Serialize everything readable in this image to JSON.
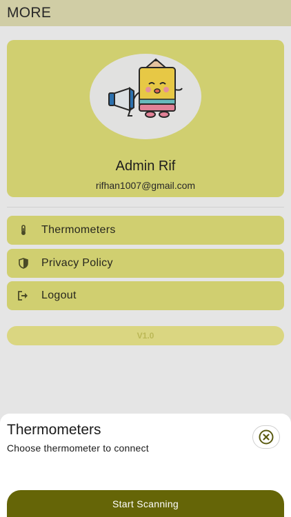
{
  "app_bar": {
    "title": "MORE"
  },
  "profile": {
    "name": "Admin Rif",
    "email": "rifhan1007@gmail.com",
    "avatar_icon": "pencil-mascot-megaphone-icon"
  },
  "menu": [
    {
      "label": "Thermometers",
      "icon": "thermometer-icon"
    },
    {
      "label": "Privacy Policy",
      "icon": "shield-icon"
    },
    {
      "label": "Logout",
      "icon": "logout-icon"
    }
  ],
  "version": "V1.0",
  "sheet": {
    "title": "Thermometers",
    "subtitle": "Choose thermometer to connect",
    "close_icon": "close-circle-icon",
    "scan_label": "Start Scanning"
  },
  "colors": {
    "accent": "#dedc78",
    "app_bar": "#dedab0",
    "primary_button": "#656507",
    "icon": "#4f4f2a"
  }
}
